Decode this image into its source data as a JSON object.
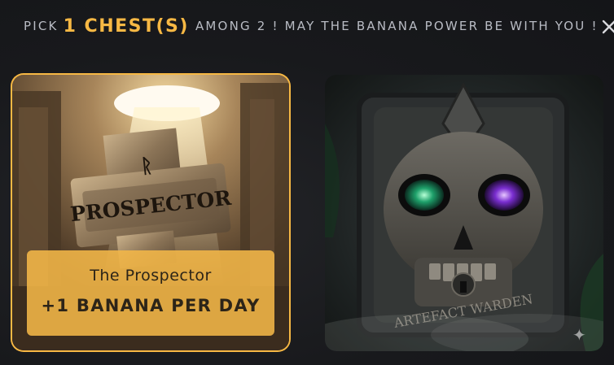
{
  "header": {
    "prefix": "PICK",
    "count": "1 CHEST(S)",
    "suffix": "AMONG 2 ! MAY THE BANANA POWER BE WITH YOU !"
  },
  "chests": [
    {
      "art_text": "PROSPECTOR",
      "name": "The Prospector",
      "bonus": "+1 BANANA PER DAY",
      "selected": true
    },
    {
      "art_text": "ARTEFACT WARDEN",
      "selected": false
    }
  ],
  "colors": {
    "accent": "#f7b844",
    "background": "#18191c",
    "muted_text": "#b9bcc4"
  },
  "icons": {
    "close": "close-icon",
    "sparkle": "sparkle-icon"
  }
}
